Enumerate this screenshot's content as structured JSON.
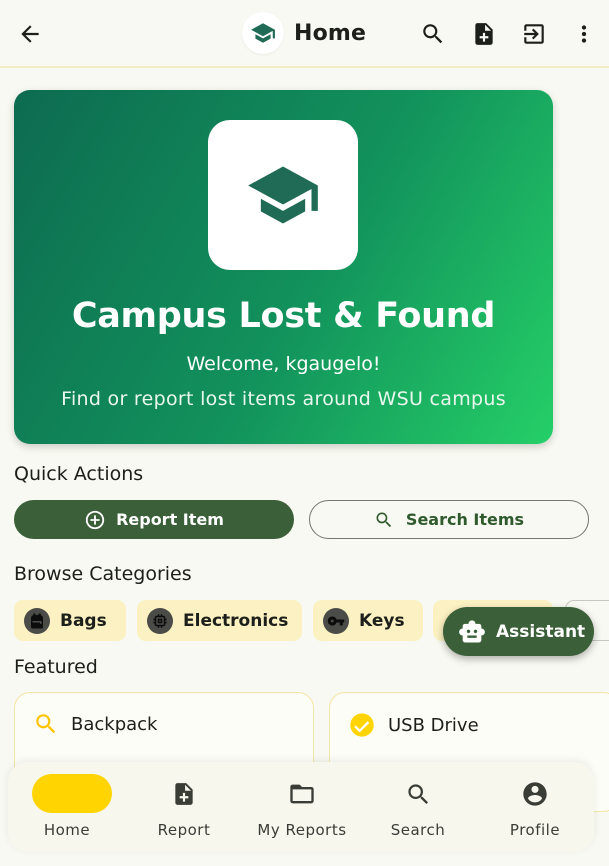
{
  "header": {
    "title": "Home",
    "back_icon": "arrow-back-icon",
    "logo_icon": "graduation-cap-icon",
    "actions": [
      "search-icon",
      "add-report-icon",
      "logout-icon",
      "more-vert-icon"
    ]
  },
  "hero": {
    "title": "Campus Lost & Found",
    "welcome": "Welcome, kgaugelo!",
    "subtitle": "Find or report lost items around WSU campus",
    "icon": "graduation-cap-icon",
    "gradient_colors": [
      "#0d6b50",
      "#25cf67"
    ]
  },
  "quick_actions": {
    "title": "Quick Actions",
    "report_label": "Report Item",
    "search_label": "Search Items"
  },
  "categories": {
    "title": "Browse Categories",
    "items": [
      {
        "label": "Bags",
        "icon": "backpack-icon"
      },
      {
        "label": "Electronics",
        "icon": "chip-icon"
      },
      {
        "label": "Keys",
        "icon": "key-icon"
      }
    ]
  },
  "assistant": {
    "label": "Assistant",
    "icon": "robot-icon"
  },
  "featured": {
    "title": "Featured",
    "items": [
      {
        "label": "Backpack",
        "icon": "search-icon",
        "icon_color": "#ffc400"
      },
      {
        "label": "USB Drive",
        "icon": "check-circle-icon",
        "icon_color": "#ffd400"
      }
    ]
  },
  "bottom_nav": {
    "items": [
      {
        "label": "Home",
        "icon": "home-icon"
      },
      {
        "label": "Report",
        "icon": "add-report-icon"
      },
      {
        "label": "My Reports",
        "icon": "folder-icon"
      },
      {
        "label": "Search",
        "icon": "search-icon"
      },
      {
        "label": "Profile",
        "icon": "account-circle-icon"
      }
    ],
    "active_color": "#ffd400"
  },
  "colors": {
    "primary": "#3b5f38",
    "background": "#f8f9f2",
    "chip": "#fbf1c2",
    "accent": "#ffd400"
  }
}
